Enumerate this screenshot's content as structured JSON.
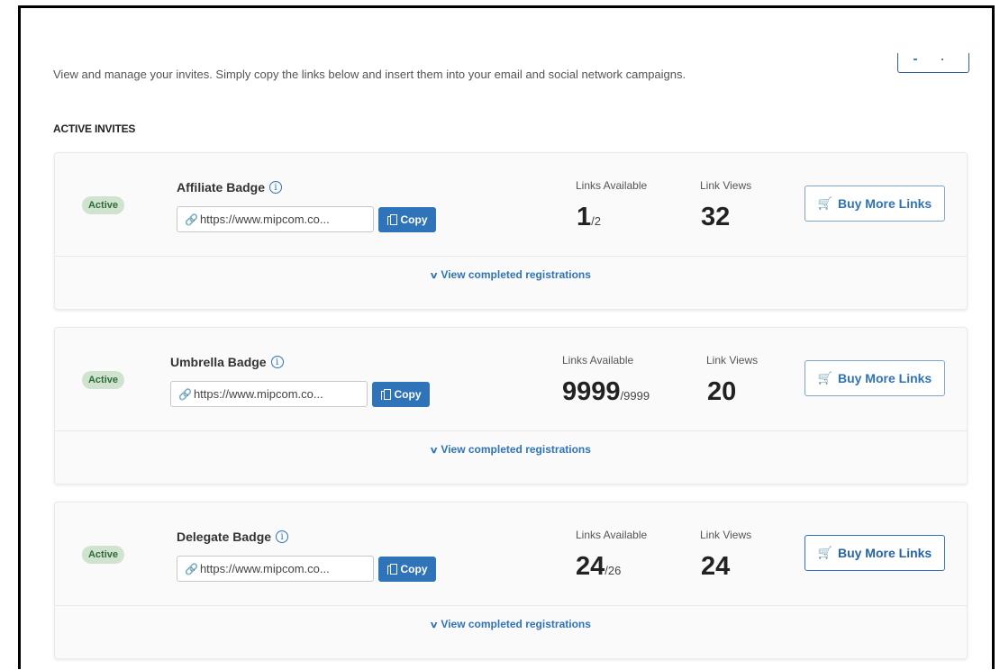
{
  "intro_text": "View and manage your invites. Simply copy the links below and insert them into your email and social network campaigns.",
  "section_title": "ACTIVE INVITES",
  "labels": {
    "links_available": "Links Available",
    "link_views": "Link Views",
    "buy_more": "Buy More Links",
    "copy": "Copy",
    "view_completed": "View completed registrations",
    "status": "Active"
  },
  "icons": {
    "info": "info-icon",
    "link": "link-icon",
    "copy": "copy-icon",
    "cart": "cart-icon",
    "chevron": "chevron-down-icon"
  },
  "colors": {
    "accent": "#2f73b8",
    "status_bg": "#cfe3cf",
    "status_text": "#2e6b3a"
  },
  "invites": [
    {
      "name": "Affiliate Badge",
      "status": "Active",
      "link": "https://www.mipcom.co...",
      "links_available": "1",
      "links_total": "/2",
      "link_views": "32"
    },
    {
      "name": "Umbrella Badge",
      "status": "Active",
      "link": "https://www.mipcom.co...",
      "links_available": "9999",
      "links_total": "/9999",
      "link_views": "20"
    },
    {
      "name": "Delegate Badge",
      "status": "Active",
      "link": "https://www.mipcom.co...",
      "links_available": "24",
      "links_total": "/26",
      "link_views": "24"
    }
  ]
}
